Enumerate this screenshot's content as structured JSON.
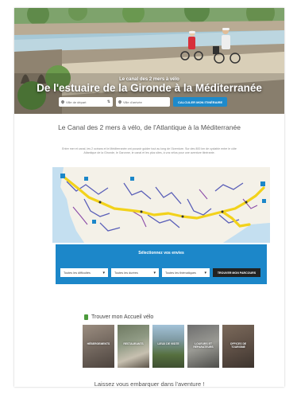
{
  "hero": {
    "kicker": "Le canal des 2 mers à vélo",
    "title": "De l'estuaire de la Gironde à la Méditerranée"
  },
  "search": {
    "from_placeholder": "Ville de départ",
    "to_placeholder": "Ville d'arrivée",
    "button_label": "CALCULER MON ITINÉRAIRE"
  },
  "intro": {
    "title": "Le Canal des 2 mers à vélo, de l'Atlantique à la Méditerranée",
    "text": "Entre mer et canal, les 2 océans et le Méditerranée ont pouvoir guider tout au long de l'Aventure. Sur des 800 km de cyclable entre le côte Atlantique de la Gironde, le Garonne, le canal et les plus sites, à vos vélos pour une aventure itinérante."
  },
  "filter": {
    "title": "Sélectionnez vos envies",
    "selects": [
      {
        "value": "Toutes les difficultés"
      },
      {
        "value": "Toutes les durées"
      },
      {
        "value": "Toutes les thématiques"
      }
    ],
    "button_label": "TROUVER MON PARCOURS"
  },
  "accueil": {
    "title": "Trouver mon Accueil vélo",
    "cards": [
      {
        "label": "HÉBERGEMENTS"
      },
      {
        "label": "RESTAURANTS"
      },
      {
        "label": "LIEUX DE VISITE"
      },
      {
        "label": "LOUEURS ET RÉPARATEURS"
      },
      {
        "label": "OFFICES DE TOURISME"
      }
    ]
  },
  "footer": {
    "title": "Laissez vous embarquer dans l'aventure !"
  },
  "colors": {
    "accent_blue": "#1c87c9",
    "route_yellow": "#f2d21b",
    "button_dark": "#222222"
  }
}
